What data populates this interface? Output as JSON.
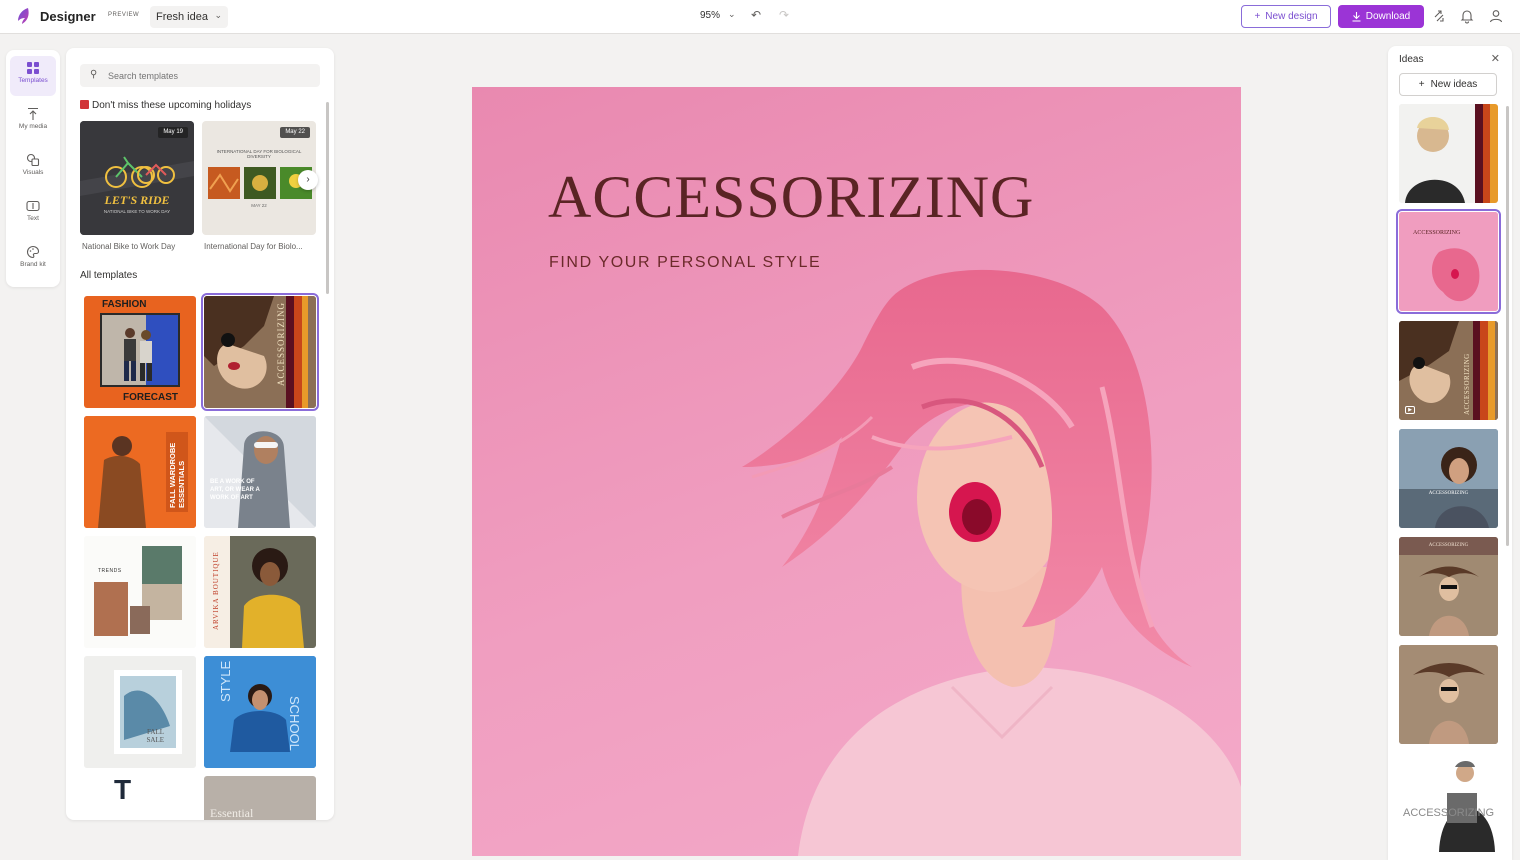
{
  "header": {
    "app_name": "Designer",
    "badge": "PREVIEW",
    "idea_select": "Fresh idea",
    "zoom": "95%",
    "new_design_label": "New design",
    "download_label": "Download"
  },
  "rail": [
    {
      "label": "Templates",
      "icon": "templates-icon",
      "active": true
    },
    {
      "label": "My media",
      "icon": "upload-icon"
    },
    {
      "label": "Visuals",
      "icon": "shapes-icon"
    },
    {
      "label": "Text",
      "icon": "text-icon"
    },
    {
      "label": "Brand kit",
      "icon": "palette-icon"
    }
  ],
  "templates_panel": {
    "search_placeholder": "Search templates",
    "holidays_title": "Don't miss these upcoming holidays",
    "holidays": [
      {
        "label": "National Bike to Work Day",
        "date": "May 19",
        "art_title": "LET'S RIDE",
        "art_sub": "NATIONAL BIKE TO WORK DAY"
      },
      {
        "label": "International Day for Biolo...",
        "date": "May 22",
        "art_title": "INTERNATIONAL DAY FOR BIOLOGICAL DIVERSITY",
        "art_sub": "MAY 22"
      }
    ],
    "all_templates_title": "All templates",
    "templates": [
      {
        "name": "fashion-forecast",
        "top": "FASHION",
        "bottom": "FORECAST"
      },
      {
        "name": "accessorizing-vertical",
        "text": "ACCESSORIZING",
        "selected": true
      },
      {
        "name": "fall-wardrobe",
        "text": "FALL WARDROBE ESSENTIALS"
      },
      {
        "name": "work-of-art",
        "text": "BE A WORK OF ART, OR WEAR A WORK OF ART"
      },
      {
        "name": "trends",
        "text": "TRENDS"
      },
      {
        "name": "arvika-boutique",
        "text": "ARVIKA BOUTIQUE"
      },
      {
        "name": "fall-sale",
        "text": "FALL SALE"
      },
      {
        "name": "style-school",
        "top": "STYLE",
        "side": "SCHOOL"
      },
      {
        "name": "t-template",
        "text": "T"
      },
      {
        "name": "essential",
        "text": "Essential"
      }
    ]
  },
  "canvas": {
    "title": "ACCESSORIZING",
    "subtitle": "FIND YOUR PERSONAL STYLE",
    "background": "#ef9bbf",
    "text_color": "#5a2424"
  },
  "ideas_panel": {
    "title": "Ideas",
    "new_ideas_label": "New ideas",
    "thumbnails": [
      {
        "name": "idea-man-stripes"
      },
      {
        "name": "idea-accessorizing-pink",
        "text": "ACCESSORIZING",
        "selected": true
      },
      {
        "name": "idea-accessorizing-brown",
        "text": "ACCESSORIZING"
      },
      {
        "name": "idea-blue-portrait",
        "text": "ACCESSORIZING"
      },
      {
        "name": "idea-tan-top",
        "text": "ACCESSORIZING"
      },
      {
        "name": "idea-tan-plain"
      },
      {
        "name": "idea-man-accessorizing",
        "text": "ACCESSORIZING"
      }
    ]
  },
  "colors": {
    "accent": "#9b34d6",
    "accent_border": "#8a6cd9",
    "canvas_pink": "#ef9bbf"
  }
}
